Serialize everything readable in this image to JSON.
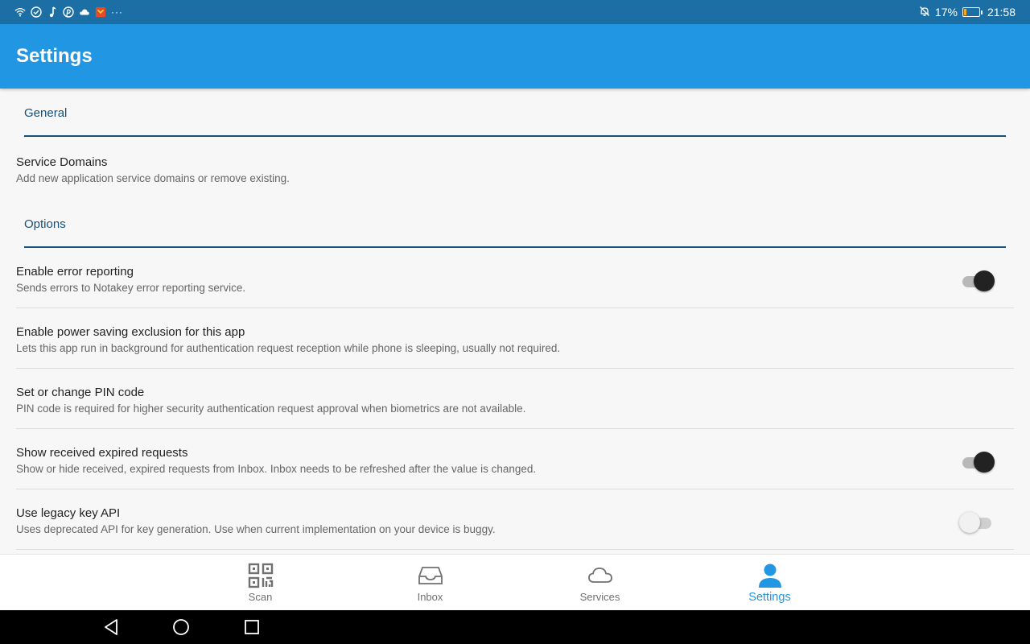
{
  "status_bar": {
    "battery_percent": "17%",
    "battery_level": 0.17,
    "time": "21:58",
    "overflow": "···",
    "colors": {
      "background": "#1c6fa5",
      "battery_fill": "#f5a623"
    },
    "icons": [
      "wifi-icon",
      "check-circle-icon",
      "music-note-icon",
      "pinterest-icon",
      "cloud-icon",
      "app-notification-icon",
      "more-icon",
      "notifications-off-icon",
      "battery-icon"
    ]
  },
  "app_bar": {
    "title": "Settings",
    "color": "#2196e3"
  },
  "sections": {
    "general": {
      "title": "General",
      "items": [
        {
          "title": "Service Domains",
          "summary": "Add new application service domains or remove existing."
        }
      ]
    },
    "options": {
      "title": "Options",
      "items": [
        {
          "title": "Enable error reporting",
          "summary": "Sends errors to Notakey error reporting service.",
          "toggle": true
        },
        {
          "title": "Enable power saving exclusion for this app",
          "summary": "Lets this app run in background for authentication request reception while phone is sleeping, usually not required."
        },
        {
          "title": "Set or change PIN code",
          "summary": "PIN code is required for higher security authentication request approval when biometrics are not available."
        },
        {
          "title": "Show received expired requests",
          "summary": "Show or hide received, expired requests from Inbox. Inbox needs to be refreshed after the value is changed.",
          "toggle": true
        },
        {
          "title": "Use legacy key API",
          "summary": "Uses deprecated API for key generation. Use when current implementation on your device is buggy.",
          "toggle": false
        }
      ]
    }
  },
  "bottom_nav": {
    "items": [
      {
        "label": "Scan",
        "icon": "qr-code-icon",
        "active": false
      },
      {
        "label": "Inbox",
        "icon": "inbox-icon",
        "active": false
      },
      {
        "label": "Services",
        "icon": "cloud-icon",
        "active": false
      },
      {
        "label": "Settings",
        "icon": "person-icon",
        "active": true
      }
    ],
    "active_color": "#2196e3"
  },
  "system_nav": {
    "icons": [
      "back-icon",
      "home-icon",
      "recents-icon"
    ]
  }
}
